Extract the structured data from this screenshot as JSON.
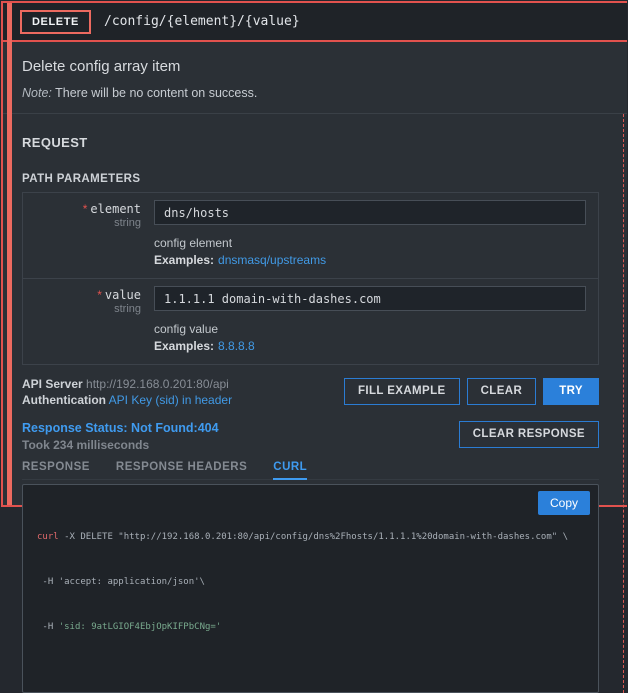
{
  "colors": {
    "accent_red": "#e2524e",
    "accent_blue": "#2b80da",
    "link_blue": "#419ae6",
    "status_blue": "#3f9bf0",
    "string_green": "#79aa8e"
  },
  "endpoint": {
    "method": "DELETE",
    "path": "/config/{element}/{value}",
    "summary": "Delete config array item",
    "note_label": "Note:",
    "note_text": " There will be no content on success."
  },
  "request": {
    "section_title": "REQUEST",
    "path_params_title": "PATH PARAMETERS",
    "params": [
      {
        "required_mark": "*",
        "name": "element",
        "type": "string",
        "value": "dns/hosts",
        "description": "config element",
        "examples_label": "Examples:",
        "example_link": "dnsmasq/upstreams"
      },
      {
        "required_mark": "*",
        "name": "value",
        "type": "string",
        "value": "1.1.1.1 domain-with-dashes.com",
        "description": "config value",
        "examples_label": "Examples:",
        "example_link": "8.8.8.8"
      }
    ],
    "api_server_label": "API Server",
    "api_server_url": "http://192.168.0.201:80/api",
    "auth_label": "Authentication",
    "auth_link": "API Key (sid) in header",
    "fill_example_button": "FILL EXAMPLE",
    "clear_button": "CLEAR",
    "try_button": "TRY"
  },
  "response": {
    "status_line": "Response Status: Not Found:404",
    "took_line": "Took 234 milliseconds",
    "clear_response_button": "CLEAR RESPONSE",
    "tabs": [
      {
        "label": "RESPONSE"
      },
      {
        "label": "RESPONSE HEADERS"
      },
      {
        "label": "CURL"
      }
    ],
    "curl_panel": {
      "copy_button": "Copy",
      "line1_cmd": "curl",
      "line1_rest": " -X DELETE \"http://192.168.0.201:80/api/config/dns%2Fhosts/1.1.1.1%20domain-with-dashes.com\" \\",
      "line2": " -H 'accept: application/json'\\",
      "line3_flag": " -H ",
      "line3_value": "'sid: 9atLGIOF4EbjOpKIFPbCNg='"
    }
  }
}
